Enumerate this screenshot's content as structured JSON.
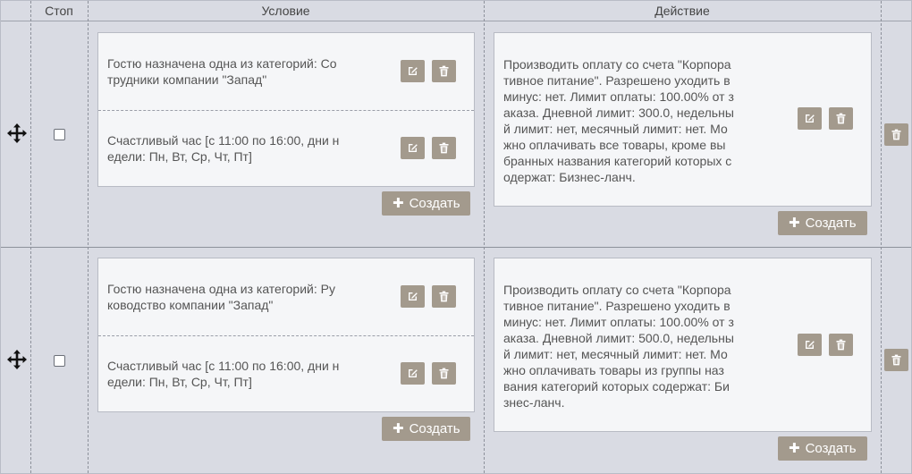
{
  "header": {
    "stop": "Стоп",
    "condition": "Условие",
    "action": "Действие"
  },
  "rows": [
    {
      "conditions": [
        {
          "text": "Гостю назначена одна из категорий: Со\nтрудники компании \"Запад\""
        },
        {
          "text": "Счастливый час [с 11:00 по 16:00, дни н\nедели: Пн, Вт, Ср, Чт, Пт]"
        }
      ],
      "action": "Производить оплату со счета \"Корпора\nтивное питание\". Разрешено уходить в\nминус: нет. Лимит оплаты: 100.00% от з\nаказа. Дневной лимит: 300.0, недельны\nй лимит: нет, месячный лимит: нет. Мо\nжно оплачивать все товары, кроме вы\nбранных названия категорий которых с\nодержат: Бизнес-ланч.",
      "create_label": "Создать"
    },
    {
      "conditions": [
        {
          "text": "Гостю назначена одна из категорий: Ру\nководство компании \"Запад\""
        },
        {
          "text": "Счастливый час [с 11:00 по 16:00, дни н\nедели: Пн, Вт, Ср, Чт, Пт]"
        }
      ],
      "action": "Производить оплату со счета \"Корпора\nтивное питание\". Разрешено уходить в\nминус: нет. Лимит оплаты: 100.00% от з\nаказа. Дневной лимит: 500.0, недельны\nй лимит: нет, месячный лимит: нет. Мо\nжно оплачивать товары из группы наз\nвания категорий которых содержат: Би\nзнес-ланч.",
      "create_label": "Создать"
    }
  ],
  "icons": {
    "drag": "move-arrows-icon",
    "edit": "edit-pencil-icon",
    "delete": "trash-icon",
    "add": "plus-icon"
  },
  "colors": {
    "background": "#d9dbe3",
    "panel": "#f5f6f8",
    "button": "#a39a8d"
  }
}
